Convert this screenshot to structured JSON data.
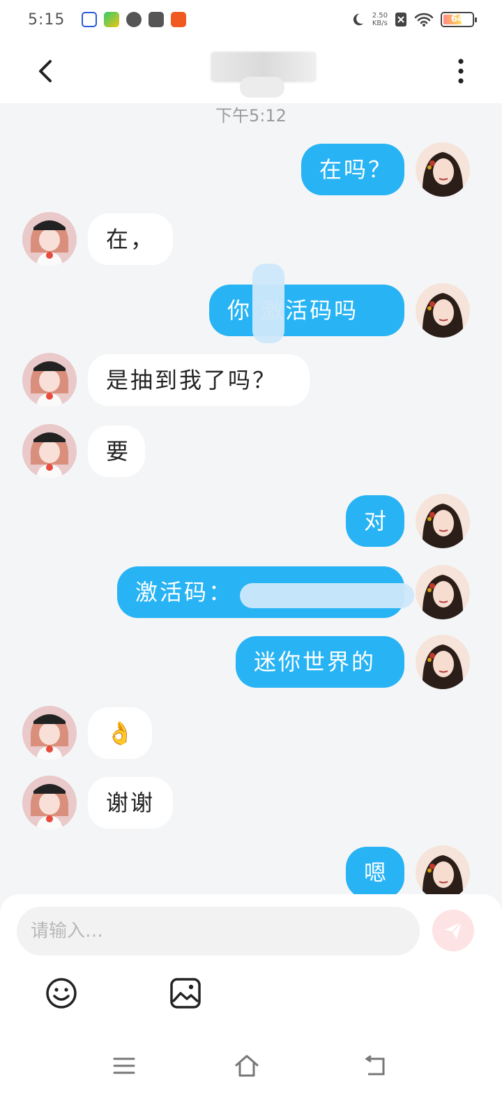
{
  "status_bar": {
    "time": "5:15",
    "net_speed_value": "2.50",
    "net_speed_unit": "KB/s",
    "battery": "64",
    "battery_level": 0.64,
    "app_icons": [
      "baidu-app-icon",
      "video-app-icon",
      "compass-app-icon",
      "mail-app-icon",
      "download-app-icon"
    ]
  },
  "header": {
    "back_icon": "chevron-left-icon",
    "more_icon": "vertical-dots-icon"
  },
  "timestamp": "下午5:12",
  "messages": [
    {
      "side": "out",
      "text": "在吗？"
    },
    {
      "side": "in",
      "text": "在，"
    },
    {
      "side": "out",
      "text": "你  激活码吗"
    },
    {
      "side": "in",
      "text": "是抽到我了吗？"
    },
    {
      "side": "in",
      "text": "要"
    },
    {
      "side": "out",
      "text": "对"
    },
    {
      "side": "out",
      "text": "激活码："
    },
    {
      "side": "out",
      "text": "迷你世界的"
    },
    {
      "side": "in",
      "text": "👌"
    },
    {
      "side": "in",
      "text": "谢谢"
    },
    {
      "side": "out",
      "text": "嗯"
    }
  ],
  "input": {
    "placeholder": "请输入…"
  },
  "toolbar": {
    "emoji_icon": "smiley-icon",
    "image_icon": "image-icon",
    "send_icon": "send-icon"
  },
  "nav": {
    "menu_icon": "menu-icon",
    "home_icon": "home-icon",
    "back_icon": "back-icon"
  },
  "colors": {
    "outgoing_bubble": "#27b3f4",
    "incoming_bubble": "#ffffff",
    "background": "#f4f5f7",
    "send_button": "#fde3e3"
  }
}
